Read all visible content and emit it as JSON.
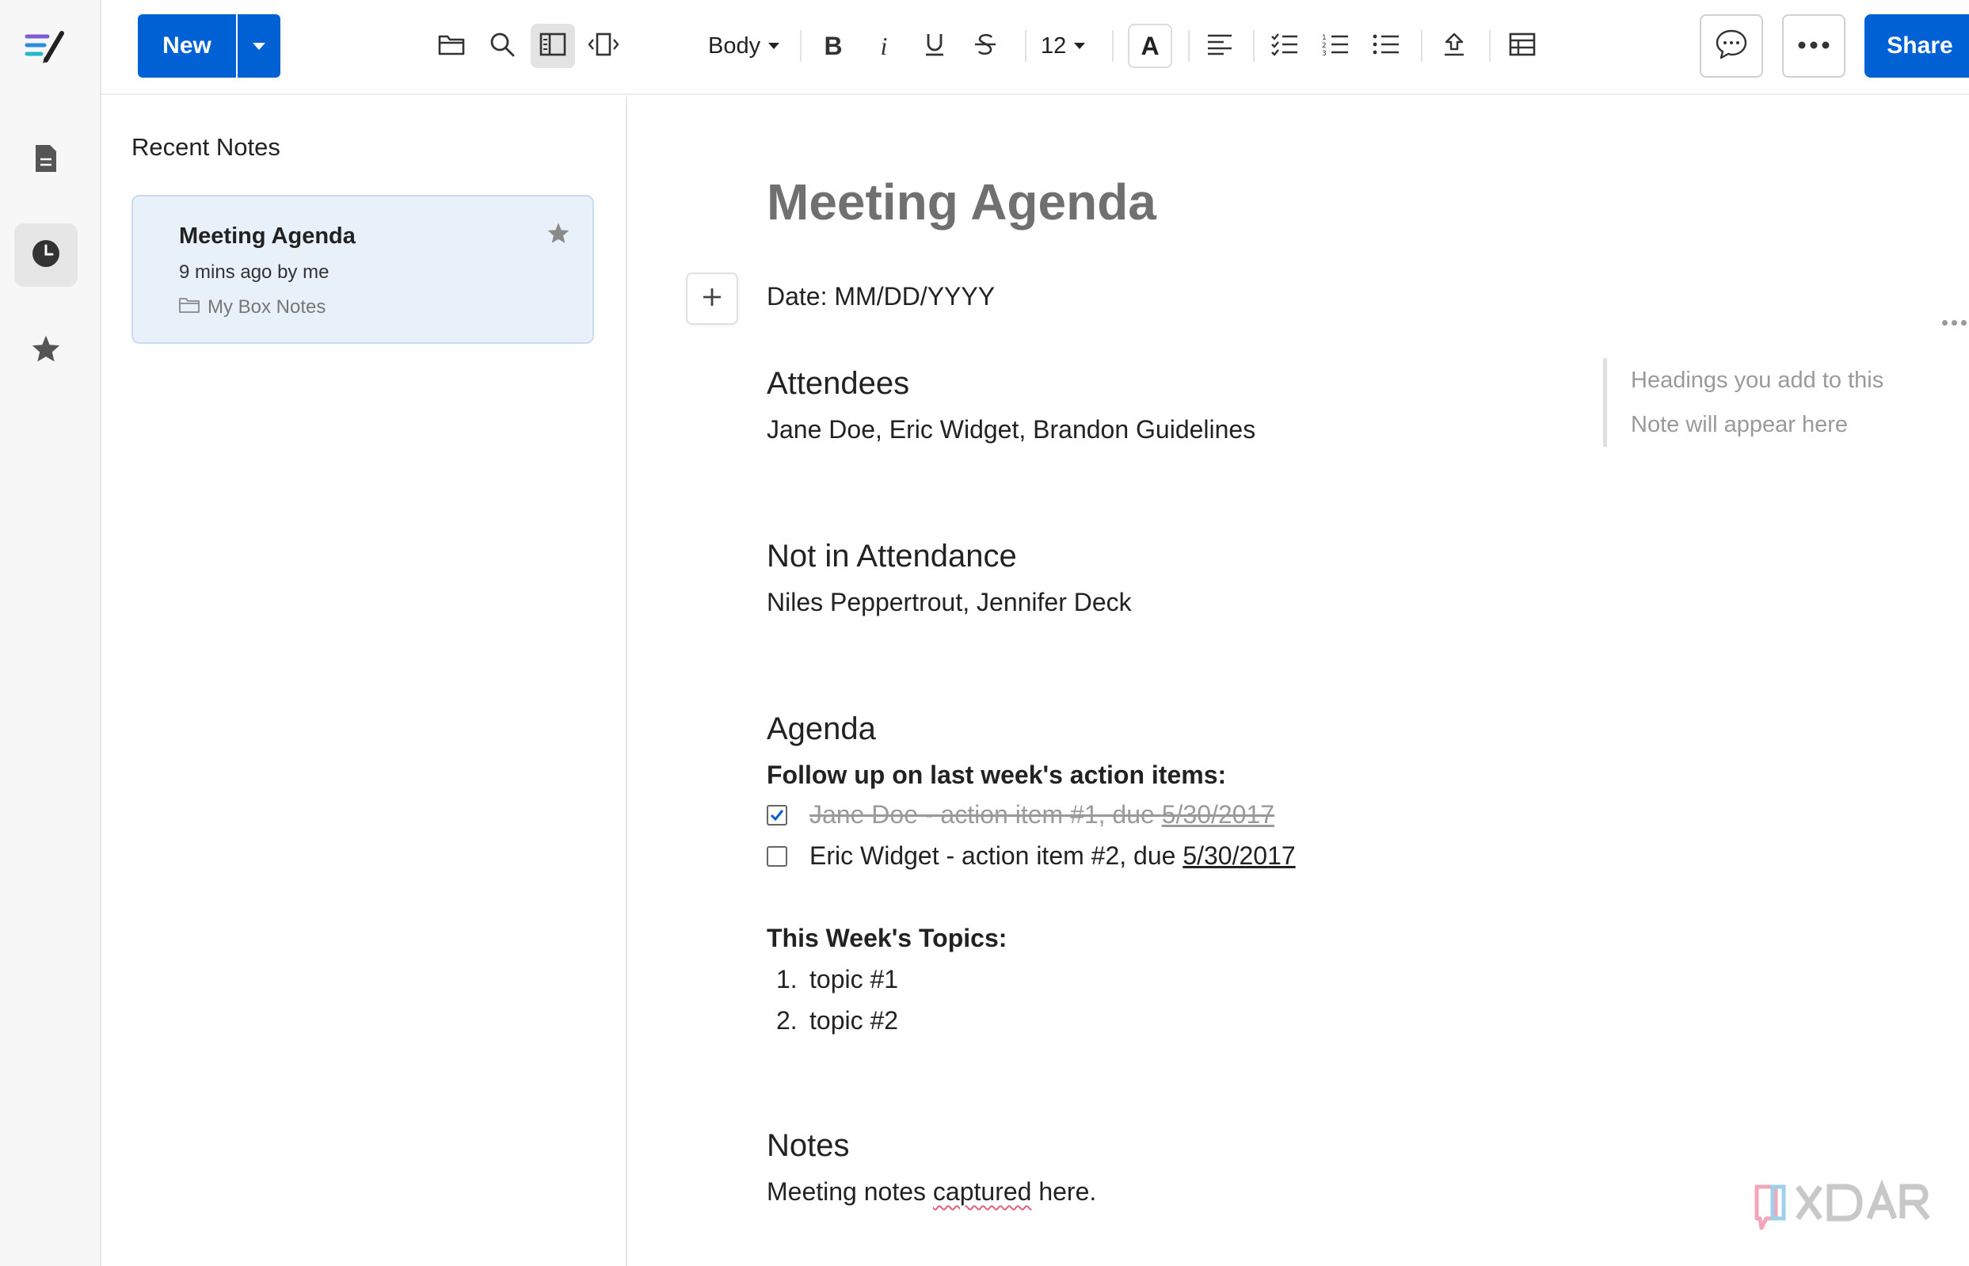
{
  "app": {
    "brand_colors": {
      "primary": "#0061d5",
      "accent_pink": "#e06080"
    }
  },
  "toolbar": {
    "new_label": "New",
    "style_label": "Body",
    "font_size": "12",
    "share_label": "Share"
  },
  "panel": {
    "title": "Recent Notes",
    "notes": [
      {
        "title": "Meeting Agenda",
        "meta": "9 mins ago by me",
        "folder": "My Box Notes"
      }
    ]
  },
  "doc": {
    "title": "Meeting Agenda",
    "date_line": "Date: MM/DD/YYYY",
    "attendees_heading": "Attendees",
    "attendees": "Jane Doe, Eric Widget, Brandon Guidelines",
    "absent_heading": "Not in Attendance",
    "absent": "Niles Peppertrout, Jennifer Deck",
    "agenda_heading": "Agenda",
    "followup_label": "Follow up on last week's action items:",
    "tasks": [
      {
        "text": "Jane Doe - action item #1, due ",
        "date": "5/30/2017",
        "checked": true
      },
      {
        "text": "Eric Widget - action item #2, due ",
        "date": "5/30/2017",
        "checked": false
      }
    ],
    "topics_label": "This Week's Topics:",
    "topics": [
      {
        "num": "1.",
        "text": "topic #1"
      },
      {
        "num": "2.",
        "text": "topic #2"
      }
    ],
    "notes_heading": "Notes",
    "notes_before": "Meeting notes ",
    "notes_misspelled": "captured",
    "notes_after": " here."
  },
  "outline": {
    "line1": "Headings you add to this",
    "line2": "Note will appear here"
  },
  "icons": {
    "rail": [
      "app-logo-icon",
      "document-icon",
      "clock-icon",
      "star-icon"
    ],
    "toolbar": [
      "folder-icon",
      "search-icon",
      "sidebar-panel-icon",
      "width-toggle-icon",
      "bold-icon",
      "italic-icon",
      "underline-icon",
      "strikethrough-icon",
      "text-color-icon",
      "align-left-icon",
      "checklist-icon",
      "numbered-list-icon",
      "bullet-list-icon",
      "upload-icon",
      "table-icon",
      "comment-icon",
      "more-icon"
    ]
  }
}
